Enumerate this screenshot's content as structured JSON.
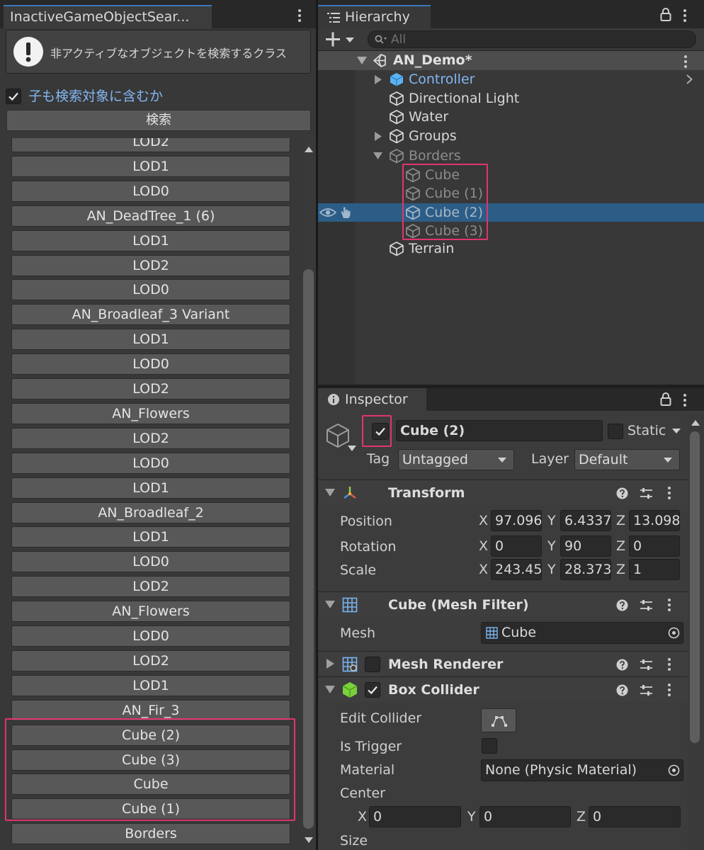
{
  "left_panel": {
    "tab_title": "InactiveGameObjectSear...",
    "help_text": "非アクティブなオブジェクトを検索するクラス",
    "include_children_label": "子も検索対象に含むか",
    "search_button": "検索",
    "results": [
      "LOD2",
      "LOD1",
      "LOD0",
      "AN_DeadTree_1 (6)",
      "LOD1",
      "LOD2",
      "LOD0",
      "AN_Broadleaf_3 Variant",
      "LOD1",
      "LOD0",
      "LOD2",
      "AN_Flowers",
      "LOD2",
      "LOD0",
      "LOD1",
      "AN_Broadleaf_2",
      "LOD1",
      "LOD0",
      "LOD2",
      "AN_Flowers",
      "LOD0",
      "LOD2",
      "LOD1",
      "AN_Fir_3",
      "Cube (2)",
      "Cube (3)",
      "Cube",
      "Cube (1)",
      "Borders"
    ]
  },
  "hierarchy": {
    "tab_title": "Hierarchy",
    "search_placeholder": "All",
    "scene_name": "AN_Demo*",
    "items": [
      {
        "label": "Controller"
      },
      {
        "label": "Directional Light"
      },
      {
        "label": "Water"
      },
      {
        "label": "Groups"
      },
      {
        "label": "Borders"
      },
      {
        "label": "Cube"
      },
      {
        "label": "Cube (1)"
      },
      {
        "label": "Cube (2)"
      },
      {
        "label": "Cube (3)"
      },
      {
        "label": "Terrain"
      }
    ]
  },
  "inspector": {
    "tab_title": "Inspector",
    "object_name": "Cube (2)",
    "static_label": "Static",
    "tag_label": "Tag",
    "tag_value": "Untagged",
    "layer_label": "Layer",
    "layer_value": "Default",
    "transform": {
      "title": "Transform",
      "position_label": "Position",
      "rotation_label": "Rotation",
      "scale_label": "Scale",
      "position": {
        "x": "97.096",
        "y": "6.4337",
        "z": "13.098"
      },
      "rotation": {
        "x": "0",
        "y": "90",
        "z": "0"
      },
      "scale": {
        "x": "243.45",
        "y": "28.373",
        "z": "1"
      }
    },
    "mesh_filter": {
      "title": "Cube (Mesh Filter)",
      "mesh_label": "Mesh",
      "mesh_value": "Cube"
    },
    "mesh_renderer": {
      "title": "Mesh Renderer"
    },
    "box_collider": {
      "title": "Box Collider",
      "edit_collider_label": "Edit Collider",
      "is_trigger_label": "Is Trigger",
      "material_label": "Material",
      "material_value": "None (Physic Material)",
      "center_label": "Center",
      "center": {
        "x": "0",
        "y": "0",
        "z": "0"
      },
      "size_label": "Size"
    },
    "axis_labels": {
      "x": "X",
      "y": "Y",
      "z": "Z"
    }
  },
  "colors": {
    "accent_blue": "#3a79bb",
    "selection": "#2c5d87",
    "highlight_pink": "#e0356b",
    "prefab_blue": "#84b6f2"
  },
  "icons": [
    "warning-icon",
    "checkmark-icon",
    "kebab-menu-icon",
    "lock-icon",
    "hierarchy-list-icon",
    "plus-icon",
    "search-icon",
    "unity-scene-icon",
    "cube-icon",
    "prefab-cube-icon",
    "eye-icon",
    "pick-hand-icon",
    "info-icon",
    "transform-axes-icon",
    "mesh-filter-icon",
    "box-collider-icon",
    "help-icon",
    "sliders-icon",
    "edit-collider-icon",
    "object-picker-icon",
    "chevron-right-icon"
  ]
}
